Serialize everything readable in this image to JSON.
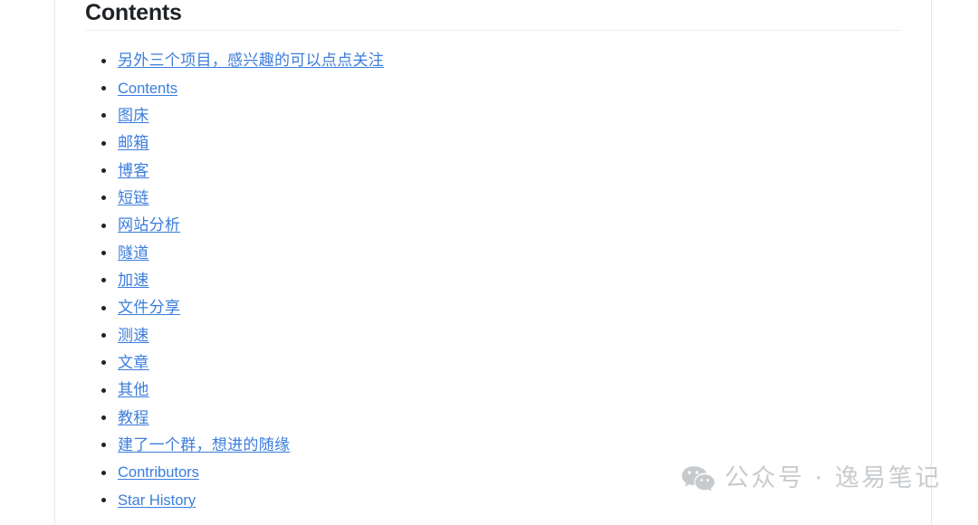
{
  "document": {
    "heading": "Contents",
    "divider_visible": true
  },
  "toc": {
    "items": [
      {
        "label": "另外三个项目，感兴趣的可以点点关注",
        "script": "cjk"
      },
      {
        "label": "Contents",
        "script": "latin"
      },
      {
        "label": "图床",
        "script": "cjk"
      },
      {
        "label": "邮箱",
        "script": "cjk"
      },
      {
        "label": "博客",
        "script": "cjk"
      },
      {
        "label": "短链",
        "script": "cjk"
      },
      {
        "label": "网站分析",
        "script": "cjk"
      },
      {
        "label": "隧道",
        "script": "cjk"
      },
      {
        "label": "加速",
        "script": "cjk"
      },
      {
        "label": "文件分享",
        "script": "cjk"
      },
      {
        "label": "测速",
        "script": "cjk"
      },
      {
        "label": "文章",
        "script": "cjk"
      },
      {
        "label": "其他",
        "script": "cjk"
      },
      {
        "label": "教程",
        "script": "cjk"
      },
      {
        "label": "建了一个群，想进的随缘",
        "script": "cjk"
      },
      {
        "label": "Contributors",
        "script": "latin"
      },
      {
        "label": "Star History",
        "script": "latin"
      }
    ]
  },
  "watermark": {
    "icon": "wechat-icon",
    "text": "公众号 · 逸易笔记"
  },
  "colors": {
    "link": "#3b7ddd",
    "heading": "#1f2328",
    "rule": "#eaecf0",
    "frame_rule": "#e3e7ec",
    "watermark": "#c9cccf",
    "background": "#ffffff"
  }
}
